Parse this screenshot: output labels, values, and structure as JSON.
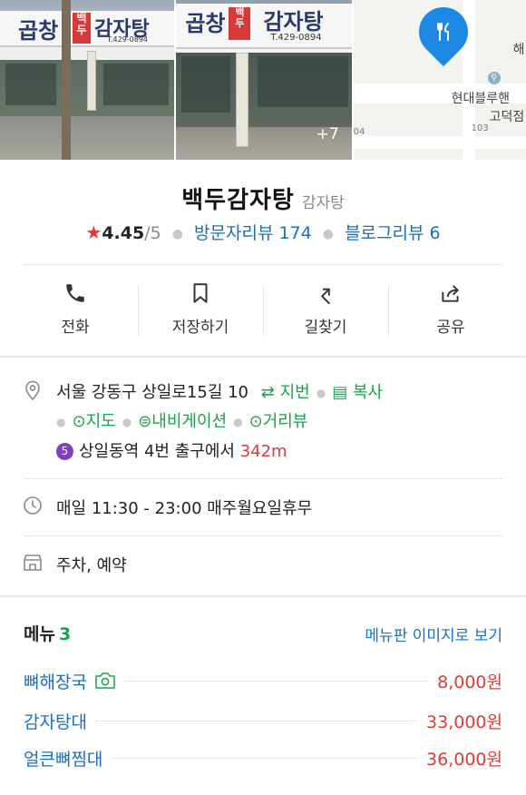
{
  "photos": {
    "sign1": {
      "left_text": "곱창",
      "red_text": "백\n두",
      "right_text": "감자탕",
      "phone": "T.429-0894"
    },
    "sign2": {
      "left_text": "곱창",
      "red_text": "백두",
      "right_text": "감자탕",
      "phone": "T.429-0894"
    },
    "more_count": "+7",
    "map": {
      "label_main": "현대블루핸",
      "label_sub": "고덕점",
      "label_edge": "해",
      "num_104": "04",
      "num_103": "103"
    }
  },
  "place": {
    "name": "백두감자탕",
    "category": "감자탕",
    "rating_star": "★",
    "rating": "4.45",
    "rating_max": "/5",
    "visitor_reviews": "방문자리뷰 174",
    "blog_reviews": "블로그리뷰 6"
  },
  "actions": [
    {
      "label": "전화",
      "icon": "phone-icon"
    },
    {
      "label": "저장하기",
      "icon": "bookmark-icon"
    },
    {
      "label": "길찾기",
      "icon": "directions-icon"
    },
    {
      "label": "공유",
      "icon": "share-icon"
    }
  ],
  "address": {
    "text": "서울 강동구 상일로15길 10",
    "jibun": "지번",
    "copy": "복사",
    "map": "지도",
    "navigation": "내비게이션",
    "streetview": "거리뷰"
  },
  "subway": {
    "line": "5",
    "station": "상일동역",
    "exit_text": "4번 출구에서",
    "distance": "342m"
  },
  "hours": {
    "text": "매일 11:30 - 23:00 매주월요일휴무"
  },
  "facilities": {
    "text": "주차, 예약"
  },
  "menu": {
    "title": "메뉴",
    "count": "3",
    "image_link": "메뉴판 이미지로 보기",
    "items": [
      {
        "name": "뼈해장국",
        "price": "8,000원",
        "has_photo": true
      },
      {
        "name": "감자탕대",
        "price": "33,000원",
        "has_photo": false
      },
      {
        "name": "얼큰뼈찜대",
        "price": "36,000원",
        "has_photo": false
      }
    ]
  },
  "colors": {
    "link_blue": "#1a6fbd",
    "price_red": "#e53935",
    "green": "#17a34a",
    "line5_purple": "#7e3fc3",
    "pin_blue": "#1e88e5"
  }
}
